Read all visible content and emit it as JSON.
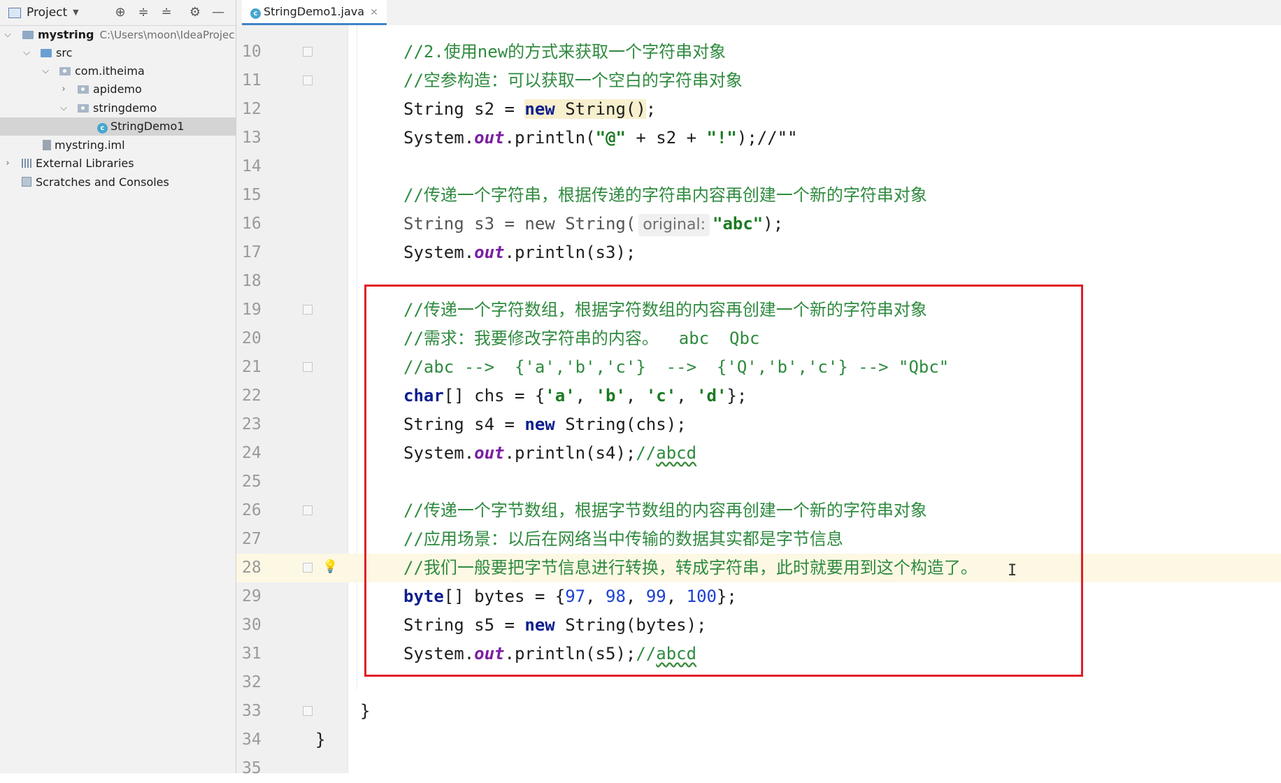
{
  "project_panel": {
    "title": "Project",
    "tree": [
      {
        "label": "mystring",
        "path": "C:\\Users\\moon\\IdeaProjec"
      },
      {
        "label": "src"
      },
      {
        "label": "com.itheima"
      },
      {
        "label": "apidemo"
      },
      {
        "label": "stringdemo"
      },
      {
        "label": "StringDemo1"
      },
      {
        "label": "mystring.iml"
      },
      {
        "label": "External Libraries"
      },
      {
        "label": "Scratches and Consoles"
      }
    ]
  },
  "editor": {
    "tab_label": "StringDemo1.java",
    "lines": [
      {
        "n": "10",
        "t": [
          "//2.使用new的方式来获取一个字符串对象"
        ]
      },
      {
        "n": "11",
        "t": [
          "//空参构造：可以获取一个空白的字符串对象"
        ]
      },
      {
        "n": "12",
        "t": [
          "String s2 = ",
          "new",
          " ",
          "String()",
          ";"
        ]
      },
      {
        "n": "13",
        "t": [
          "System.",
          "out",
          ".println(",
          "\"@\"",
          " + s2 + ",
          "\"!\"",
          ");//\"\""
        ]
      },
      {
        "n": "14",
        "t": []
      },
      {
        "n": "15",
        "t": [
          "//传递一个字符串，根据传递的字符串内容再创建一个新的字符串对象"
        ]
      },
      {
        "n": "16",
        "t": [
          "String s3 = new String(",
          "original:",
          "\"abc\"",
          ");"
        ]
      },
      {
        "n": "17",
        "t": [
          "System.",
          "out",
          ".println(s3);"
        ]
      },
      {
        "n": "18",
        "t": []
      },
      {
        "n": "19",
        "t": [
          "//传递一个字符数组，根据字符数组的内容再创建一个新的字符串对象"
        ]
      },
      {
        "n": "20",
        "t": [
          "//需求：我要修改字符串的内容。  ",
          "abc  Qbc"
        ]
      },
      {
        "n": "21",
        "t": [
          "//abc -->  {'a','b','c'}  -->  {'Q','b','c'} --> \"Qbc\""
        ]
      },
      {
        "n": "22",
        "t": [
          "char",
          "[] chs = {",
          "'a'",
          ", ",
          "'b'",
          ", ",
          "'c'",
          ", ",
          "'d'",
          "};"
        ]
      },
      {
        "n": "23",
        "t": [
          "String s4 = ",
          "new",
          " String(chs);"
        ]
      },
      {
        "n": "24",
        "t": [
          "System.",
          "out",
          ".println(s4);",
          "//",
          "abcd"
        ]
      },
      {
        "n": "25",
        "t": []
      },
      {
        "n": "26",
        "t": [
          "//传递一个字节数组，根据字节数组的内容再创建一个新的字符串对象"
        ]
      },
      {
        "n": "27",
        "t": [
          "//应用场景：以后在网络当中传输的数据其实都是字节信息"
        ]
      },
      {
        "n": "28",
        "t": [
          "//我们一般要把字节信息进行转换，转成字符串，此时就要用到这个构造了。"
        ]
      },
      {
        "n": "29",
        "t": [
          "byte",
          "[] bytes = {",
          "97",
          ", ",
          "98",
          ", ",
          "99",
          ", ",
          "100",
          "};"
        ]
      },
      {
        "n": "30",
        "t": [
          "String s5 = ",
          "new",
          " String(bytes);"
        ]
      },
      {
        "n": "31",
        "t": [
          "System.",
          "out",
          ".println(s5);",
          "//",
          "abcd"
        ]
      },
      {
        "n": "32",
        "t": []
      },
      {
        "n": "33",
        "t": [
          "}"
        ]
      },
      {
        "n": "34",
        "t": [
          "}"
        ]
      },
      {
        "n": "35",
        "t": []
      }
    ]
  },
  "colors": {
    "comment": "#2f8a3f",
    "keyword": "#0d1e8e",
    "string": "#1b7a22",
    "number": "#1b3fd4",
    "annotation_box": "#e01e26"
  }
}
